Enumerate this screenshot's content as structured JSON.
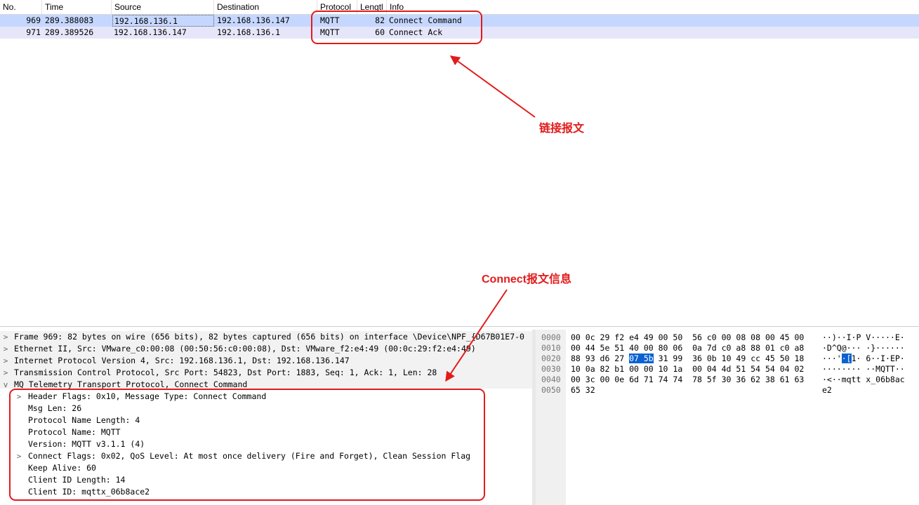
{
  "packet_list": {
    "columns": [
      "No.",
      "Time",
      "Source",
      "Destination",
      "Protocol",
      "Lengtl",
      "Info"
    ],
    "rows": [
      {
        "no": "969",
        "time": "289.388083",
        "source": "192.168.136.1",
        "destination": "192.168.136.147",
        "protocol": "MQTT",
        "length": "82",
        "info": "Connect Command"
      },
      {
        "no": "971",
        "time": "289.389526",
        "source": "192.168.136.147",
        "destination": "192.168.136.1",
        "protocol": "MQTT",
        "length": "60",
        "info": "Connect Ack"
      }
    ]
  },
  "details": {
    "top_lines": [
      {
        "arrow": ">",
        "text": "Frame 969: 82 bytes on wire (656 bits), 82 bytes captured (656 bits) on interface \\Device\\NPF_{D67B01E7-0"
      },
      {
        "arrow": ">",
        "text": "Ethernet II, Src: VMware_c0:00:08 (00:50:56:c0:00:08), Dst: VMware_f2:e4:49 (00:0c:29:f2:e4:49)"
      },
      {
        "arrow": ">",
        "text": "Internet Protocol Version 4, Src: 192.168.136.1, Dst: 192.168.136.147"
      },
      {
        "arrow": ">",
        "text": "Transmission Control Protocol, Src Port: 54823, Dst Port: 1883, Seq: 1, Ack: 1, Len: 28"
      },
      {
        "arrow": "v",
        "text": "MQ Telemetry Transport Protocol, Connect Command"
      }
    ],
    "mqtt_fields": [
      {
        "arrow": ">",
        "text": "Header Flags: 0x10, Message Type: Connect Command"
      },
      {
        "arrow": "",
        "text": "Msg Len: 26"
      },
      {
        "arrow": "",
        "text": "Protocol Name Length: 4"
      },
      {
        "arrow": "",
        "text": "Protocol Name: MQTT"
      },
      {
        "arrow": "",
        "text": "Version: MQTT v3.1.1 (4)"
      },
      {
        "arrow": ">",
        "text": "Connect Flags: 0x02, QoS Level: At most once delivery (Fire and Forget), Clean Session Flag"
      },
      {
        "arrow": "",
        "text": "Keep Alive: 60"
      },
      {
        "arrow": "",
        "text": "Client ID Length: 14"
      },
      {
        "arrow": "",
        "text": "Client ID: mqttx_06b8ace2"
      }
    ]
  },
  "bytes": {
    "lines": [
      {
        "offset": "0000",
        "hex": "00 0c 29 f2 e4 49 00 50  56 c0 00 08 08 00 45 00",
        "ascii": "··)··I·P V·····E·"
      },
      {
        "offset": "0010",
        "hex": "00 44 5e 51 40 00 80 06  0a 7d c0 a8 88 01 c0 a8",
        "ascii": "·D^Q@··· ·}······"
      },
      {
        "offset": "0020",
        "hex_a": "88 93 d6 27 ",
        "hex_hl": "07 5b",
        "hex_b": " 31 99  36 0b 10 49 cc 45 50 18",
        "ascii_a": "···'",
        "ascii_hl": "·[",
        "ascii_b": "1· 6··I·EP·"
      },
      {
        "offset": "0030",
        "hex": "10 0a 82 b1 00 00 10 1a  00 04 4d 51 54 54 04 02",
        "ascii": "········ ··MQTT··"
      },
      {
        "offset": "0040",
        "hex": "00 3c 00 0e 6d 71 74 74  78 5f 30 36 62 38 61 63",
        "ascii": "·<··mqtt x_06b8ac"
      },
      {
        "offset": "0050",
        "hex": "65 32",
        "ascii": "e2"
      }
    ]
  },
  "annotations": {
    "packet_label": "链接报文",
    "details_label": "Connect报文信息"
  },
  "colors": {
    "selected_row": "#c6d7ff",
    "second_row": "#e6e6fa",
    "annotation_red": "#e21b1b",
    "byte_highlight": "#0a62d0"
  }
}
